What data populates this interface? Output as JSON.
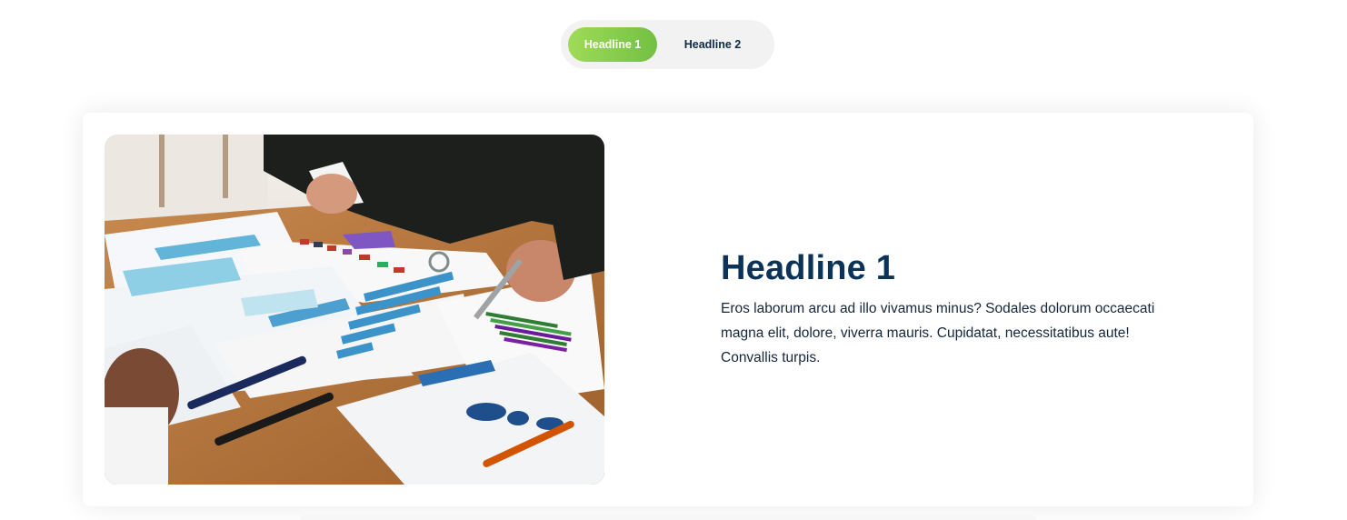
{
  "tabs": [
    {
      "label": "Headline 1",
      "active": true
    },
    {
      "label": "Headline 2",
      "active": false
    }
  ],
  "card": {
    "image_alt": "Business people reviewing charts and reports on a wooden desk",
    "headline": "Headline 1",
    "body": "Eros laborum arcu ad illo vivamus minus? Sodales dolorum occaecati magna elit, dolore, viverra mauris. Cupidatat, necessitatibus aute! Convallis turpis."
  },
  "colors": {
    "accent_green_start": "#9fdb58",
    "accent_green_end": "#73c043",
    "headline_navy": "#0b3358",
    "tab_background": "#f2f2f2"
  }
}
